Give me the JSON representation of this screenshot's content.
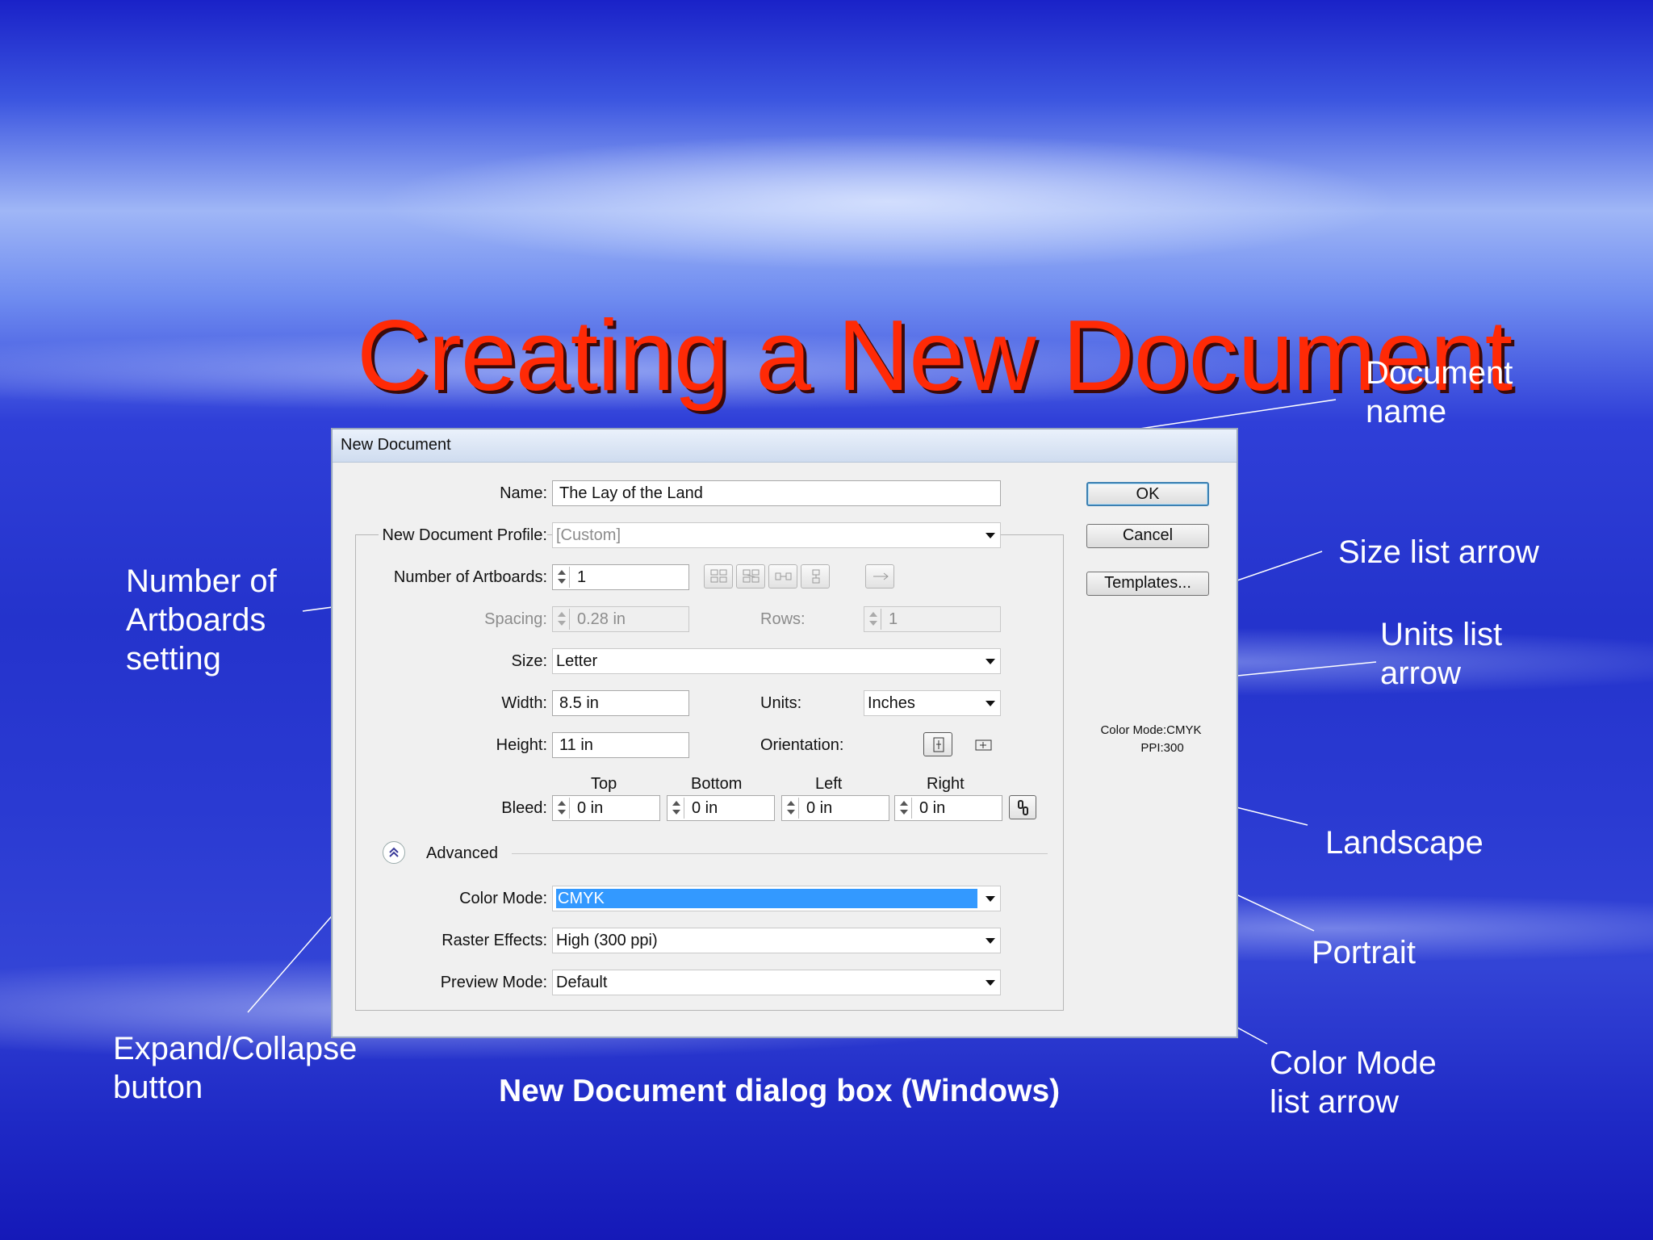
{
  "slide": {
    "title": "Creating a New Document",
    "caption": "New Document dialog box (Windows)",
    "callouts": {
      "document_name": [
        "Document",
        "name"
      ],
      "size_list_arrow": "Size list arrow",
      "units_list_arrow": [
        "Units list",
        "arrow"
      ],
      "number_of_artboards": [
        "Number of",
        "Artboards",
        "setting"
      ],
      "landscape": "Landscape",
      "portrait": "Portrait",
      "expand_collapse": [
        "Expand/Collapse",
        "button"
      ],
      "color_mode_arrow": [
        "Color Mode",
        "list arrow"
      ]
    },
    "colors": {
      "title": "#ff2a06",
      "callout_text": "#ffffff",
      "background": "#2433cc"
    }
  },
  "dialog": {
    "title": "New Document",
    "name_label": "Name:",
    "name_value": "The Lay of the Land",
    "profile_label": "New Document Profile:",
    "profile_value": "[Custom]",
    "artboards_label": "Number of Artboards:",
    "artboards_value": "1",
    "spacing_label": "Spacing:",
    "spacing_value": "0.28 in",
    "rows_label": "Rows:",
    "rows_value": "1",
    "size_label": "Size:",
    "size_value": "Letter",
    "width_label": "Width:",
    "width_value": "8.5 in",
    "units_label": "Units:",
    "units_value": "Inches",
    "height_label": "Height:",
    "height_value": "11 in",
    "orientation_label": "Orientation:",
    "bleed_label": "Bleed:",
    "bleed_headers": {
      "top": "Top",
      "bottom": "Bottom",
      "left": "Left",
      "right": "Right"
    },
    "bleed_values": {
      "top": "0 in",
      "bottom": "0 in",
      "left": "0 in",
      "right": "0 in"
    },
    "advanced_label": "Advanced",
    "color_mode_label": "Color Mode:",
    "color_mode_value": "CMYK",
    "raster_label": "Raster Effects:",
    "raster_value": "High (300 ppi)",
    "preview_label": "Preview Mode:",
    "preview_value": "Default",
    "buttons": {
      "ok": "OK",
      "cancel": "Cancel",
      "templates": "Templates..."
    },
    "info": {
      "color_mode": "Color Mode:CMYK",
      "ppi": "PPI:300"
    },
    "icons": [
      "grid-by-row-icon",
      "grid-by-column-icon",
      "arrange-by-row-icon",
      "arrange-by-column-icon",
      "right-to-left-icon",
      "portrait-icon",
      "landscape-icon",
      "link-bleed-icon",
      "expand-collapse-icon"
    ]
  }
}
